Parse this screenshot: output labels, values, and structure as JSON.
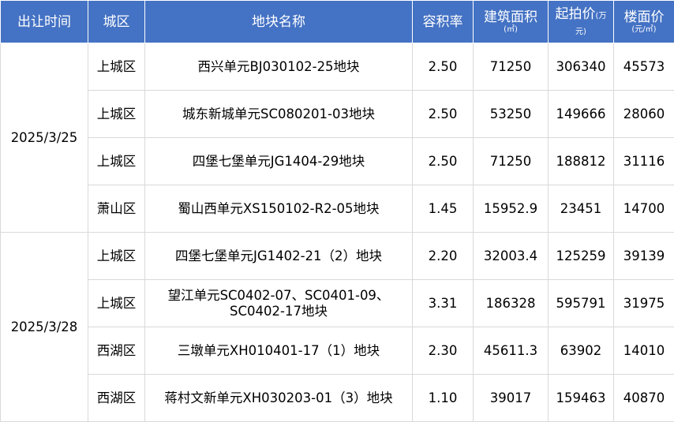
{
  "headers": {
    "date": "出让时间",
    "district": "城区",
    "plot_name": "地块名称",
    "far": "容积率",
    "area": "建筑面积",
    "area_unit": "(㎡)",
    "price": "起拍价",
    "price_unit": "(万元)",
    "unit_price": "楼面价",
    "unit_price_unit": "(元/㎡)"
  },
  "groups": [
    {
      "date": "2025/3/25",
      "rows": [
        {
          "district": "上城区",
          "plot_name": "西兴单元BJ030102-25地块",
          "far": "2.50",
          "area": "71250",
          "price": "306340",
          "unit_price": "45573"
        },
        {
          "district": "上城区",
          "plot_name": "城东新城单元SC080201-03地块",
          "far": "2.50",
          "area": "53250",
          "price": "149666",
          "unit_price": "28060"
        },
        {
          "district": "上城区",
          "plot_name": "四堡七堡单元JG1404-29地块",
          "far": "2.50",
          "area": "71250",
          "price": "188812",
          "unit_price": "31116"
        },
        {
          "district": "萧山区",
          "plot_name": "蜀山西单元XS150102-R2-05地块",
          "far": "1.45",
          "area": "15952.9",
          "price": "23451",
          "unit_price": "14700"
        }
      ]
    },
    {
      "date": "2025/3/28",
      "rows": [
        {
          "district": "上城区",
          "plot_name": "四堡七堡单元JG1402-21（2）地块",
          "far": "2.20",
          "area": "32003.4",
          "price": "125259",
          "unit_price": "39139"
        },
        {
          "district": "上城区",
          "plot_name": "望江单元SC0402-07、SC0401-09、SC0402-17地块",
          "far": "3.31",
          "area": "186328",
          "price": "595791",
          "unit_price": "31975"
        },
        {
          "district": "西湖区",
          "plot_name": "三墩单元XH010401-17（1）地块",
          "far": "2.30",
          "area": "45611.3",
          "price": "63902",
          "unit_price": "14010"
        },
        {
          "district": "西湖区",
          "plot_name": "蒋村文新单元XH030203-01（3）地块",
          "far": "1.10",
          "area": "39017",
          "price": "159463",
          "unit_price": "40870"
        }
      ]
    }
  ],
  "colors": {
    "header_bg": "#4472c4",
    "header_text": "#ffffff",
    "grid": "#d9d9d9"
  }
}
